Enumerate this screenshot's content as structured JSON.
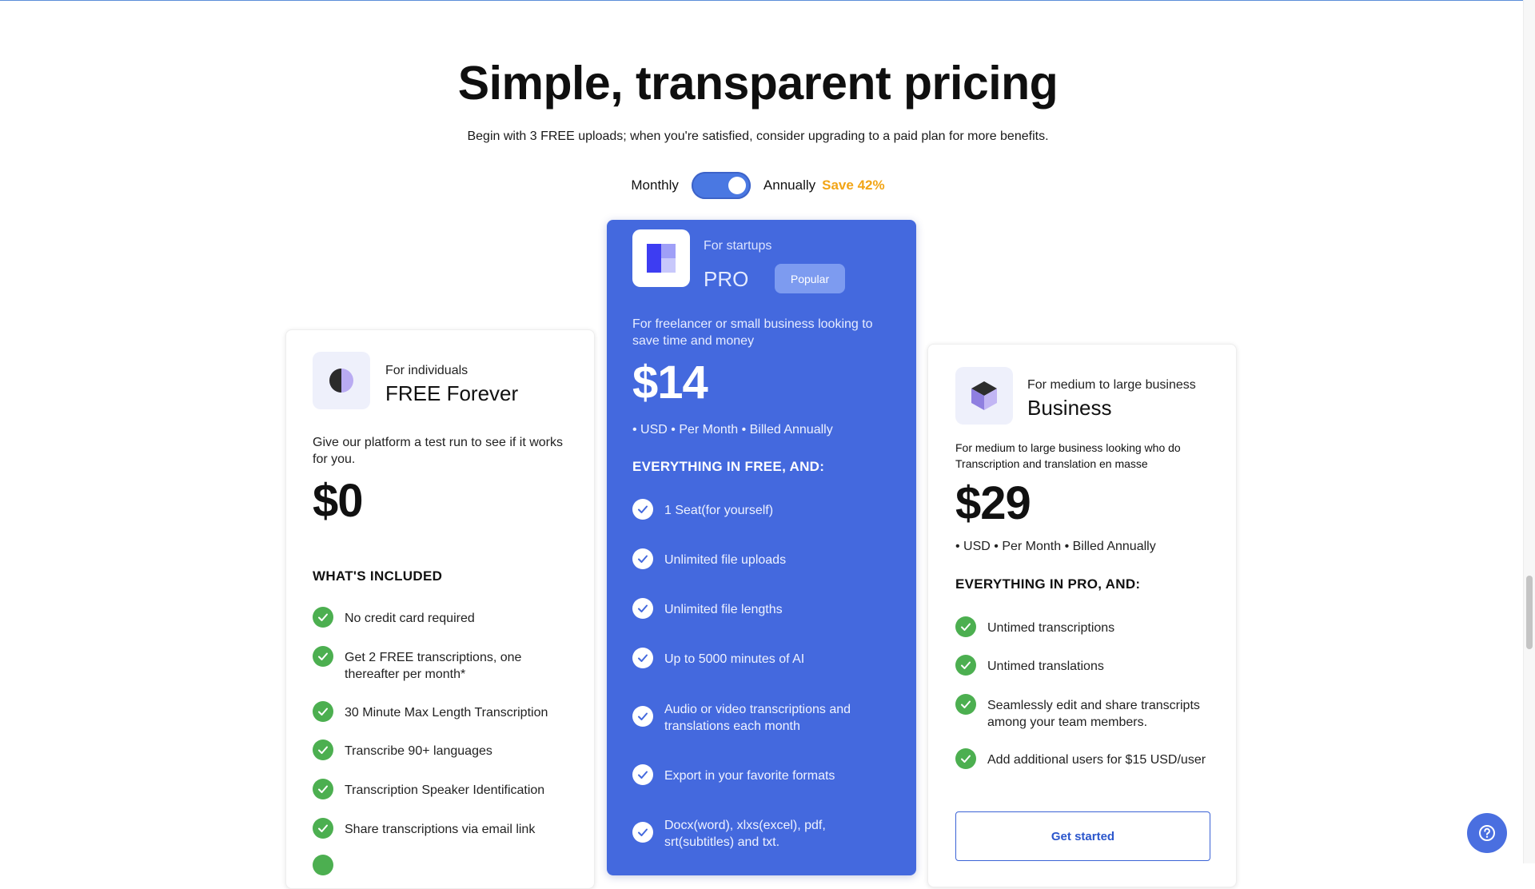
{
  "header": {
    "title": "Simple, transparent pricing",
    "subtitle": "Begin with 3 FREE uploads; when you're satisfied, consider upgrading to a paid plan for more benefits."
  },
  "billing_toggle": {
    "monthly_label": "Monthly",
    "annually_label": "Annually",
    "save_label": "Save 42%",
    "selected": "Annually"
  },
  "plans": {
    "free": {
      "audience": "For individuals",
      "name": "FREE Forever",
      "description": "Give our platform a test run to see if it works for you.",
      "price": "$0",
      "section_title": "WHAT'S INCLUDED",
      "features": [
        "No credit card required",
        "Get 2 FREE transcriptions, one thereafter per month*",
        "30 Minute Max Length Transcription",
        "Transcribe 90+ languages",
        "Transcription Speaker Identification",
        "Share transcriptions via email link"
      ]
    },
    "pro": {
      "audience": "For startups",
      "name": "PRO",
      "badge": "Popular",
      "description": "For freelancer or small business looking to save time and money",
      "price": "$14",
      "billing": "• USD • Per Month • Billed Annually",
      "section_title": "EVERYTHING IN FREE, AND:",
      "features": [
        "1 Seat(for yourself)",
        "Unlimited file uploads",
        "Unlimited file lengths",
        "Up to 5000 minutes of AI",
        "Audio or video transcriptions and translations each month",
        "Export in your favorite formats",
        "Docx(word), xlxs(excel), pdf, srt(subtitles) and txt."
      ]
    },
    "business": {
      "audience": "For medium to large business",
      "name": "Business",
      "description": "For medium to large business looking who do Transcription and translation en masse",
      "price": "$29",
      "billing": "• USD • Per Month • Billed Annually",
      "section_title": "EVERYTHING IN PRO, AND:",
      "features": [
        "Untimed transcriptions",
        "Untimed translations",
        "Seamlessly edit and share transcripts among your team members.",
        "Add additional users for $15 USD/user"
      ],
      "cta": "Get started"
    }
  },
  "colors": {
    "accent_blue": "#4469de",
    "save_orange": "#f2a516",
    "check_green": "#4caf50"
  },
  "icons": [
    "half-circle-icon",
    "pro-logo-icon",
    "cube-icon",
    "check-icon",
    "help-icon"
  ]
}
